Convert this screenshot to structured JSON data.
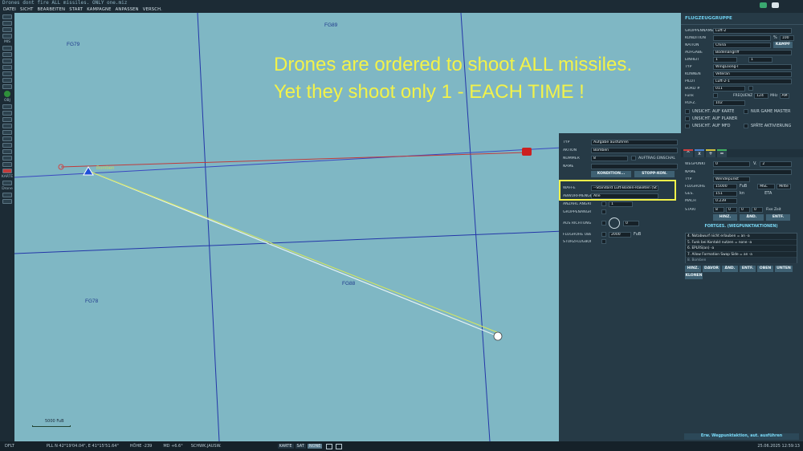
{
  "window": {
    "title": "Drones dont fire ALL missiles. ONLY one.miz"
  },
  "menu": [
    "DATEI",
    "SICHT",
    "BEARBEITEN",
    "START",
    "KAMPAGNE",
    "ANPASSEN",
    "VERSCH."
  ],
  "left_toolbar": {
    "section1": "MIS",
    "section2": "OBJ",
    "section3": "KARTE",
    "drone_label": "Drone"
  },
  "map": {
    "grid_labels": [
      "FG79",
      "FG89",
      "FG78",
      "FG88"
    ],
    "annotation_line1": "Drones are ordered to shoot ALL missiles.",
    "annotation_line2": "Yet they shoot only 1 - EACH TIME !",
    "unit_label": "Bomben",
    "scale_label": "5000 FuB"
  },
  "group_panel": {
    "title": "FLUGZEUGGRUPPE",
    "fields": {
      "gruppenname": {
        "label": "GRUPPENNAME",
        "value": "Luft-2"
      },
      "kondition": {
        "label": "KONDITION",
        "value": "100",
        "unit": "%"
      },
      "nation": {
        "label": "NATION",
        "value": "China",
        "button": "KAMPF"
      },
      "aufgabe": {
        "label": "AUFGABE",
        "value": "Bodenangriff"
      },
      "einheit": {
        "label": "EINHEIT",
        "value": "1",
        "value2": "1"
      },
      "typ": {
        "label": "TYP",
        "value": "WingLoong-I"
      },
      "koennen": {
        "label": "KÖNNEN",
        "value": "Veteran"
      },
      "pilot": {
        "label": "PILOT",
        "value": "Luft-2-1"
      },
      "bord": {
        "label": "BORD #",
        "value": "011"
      },
      "funk": {
        "label": "Funk",
        "frequenz_label": "FREQUENZ",
        "frequenz": "124",
        "unit": "MHz",
        "mod": "AM"
      },
      "rufz": {
        "label": "RUFZ.",
        "value": "102"
      }
    },
    "checkboxes": [
      "UNSICHT. AUF KARTE",
      "NUR GAME MASTER",
      "UNSICHT. AUF PLANER",
      "UNSICHT. AUF MFD",
      "SPÄTE AKTIVIERUNG"
    ],
    "waypoint": {
      "wegpunkt_label": "WEGPUNKT",
      "wegpunkt": "0",
      "von_label": "V.",
      "von": "2",
      "name_label": "NAME",
      "typ_label": "TYP",
      "typ": "Wendepunkt",
      "hoehe_label": "FLUGHÖHE",
      "hoehe": "15000",
      "hoehe_unit": "FuB",
      "hoehe_ref": "MSL",
      "hoehe_mode": "Mitte",
      "ges_label": "GES.",
      "ges": "151",
      "ges_unit": "kn",
      "eta_label": "ETA",
      "mach_label": "MACH",
      "mach": "0.239",
      "start_label": "START",
      "start": [
        "8",
        "0",
        "0",
        "0"
      ],
      "fixe_zeit": "Fixe Zeit"
    },
    "wp_buttons": [
      "HINZ.",
      "ÄND.",
      "ENTF."
    ],
    "actions_title": "FORTGES. (WEGPUNKTAKTIONEN)",
    "actions": [
      "4. Notabwurf nicht erlauben = an -a",
      "5. Funk bei Kontakt nutzen = none -a",
      "6. EPLRS(an) -a",
      "7. Allow Formation Swap Side = an -a",
      "8. Bomben"
    ],
    "action_buttons": [
      "HINZ.",
      "DAVOR",
      "ÄND.",
      "ENTF.",
      "OBEN",
      "UNTEN",
      "KLONEN"
    ],
    "bottom_button": "Erw. Wegpunktaktion, aut. ausführen"
  },
  "mission_panel": {
    "typ_label": "TYP",
    "typ": "Aufgabe ausführen",
    "aktion_label": "AKTION",
    "aktion": "Bomben",
    "nummer_label": "NUMMER",
    "nummer": "8",
    "auftrag": "AUFTRAG EINSCHAL",
    "name_label": "NAME",
    "kondition_btn": "KONDITION...",
    "stopp_btn": "STOPP-KON.",
    "waffe_label": "WAFFE",
    "waffe": "--Standard Luft-Boden-Raketen (St",
    "abwurf_label": "ABWURFMENGE",
    "abwurf": "Alle",
    "anzahl_label": "ANZAHL ANGRIFFE",
    "anzahl": "1",
    "gruppen_label": "GRUPPENANGRIFF",
    "richtung_label": "AUS RICHTUNG",
    "richtung": "0",
    "hoehe_label": "FLUGHÖHE ÜBER",
    "hoehe": "2000",
    "hoehe_unit": "FuB",
    "sturz_label": "STURZFLUGBOMBE"
  },
  "status": {
    "mode": "DFLT",
    "coords": "PLL  N 42°19'04.04\", E 41°15'51.64\"",
    "hoehe": "HÖHE  -239",
    "md": "MD  +6.6°",
    "schwk": "SCHWK.JAUSW.",
    "karte": "KARTE",
    "sat": "SAT",
    "none": "NONE",
    "datetime": "25.06.2025 12:59:13"
  },
  "colors": {
    "map_bg": "#7fb7c4",
    "annotation": "#f2f24a",
    "accent": "#6fd0f0"
  }
}
